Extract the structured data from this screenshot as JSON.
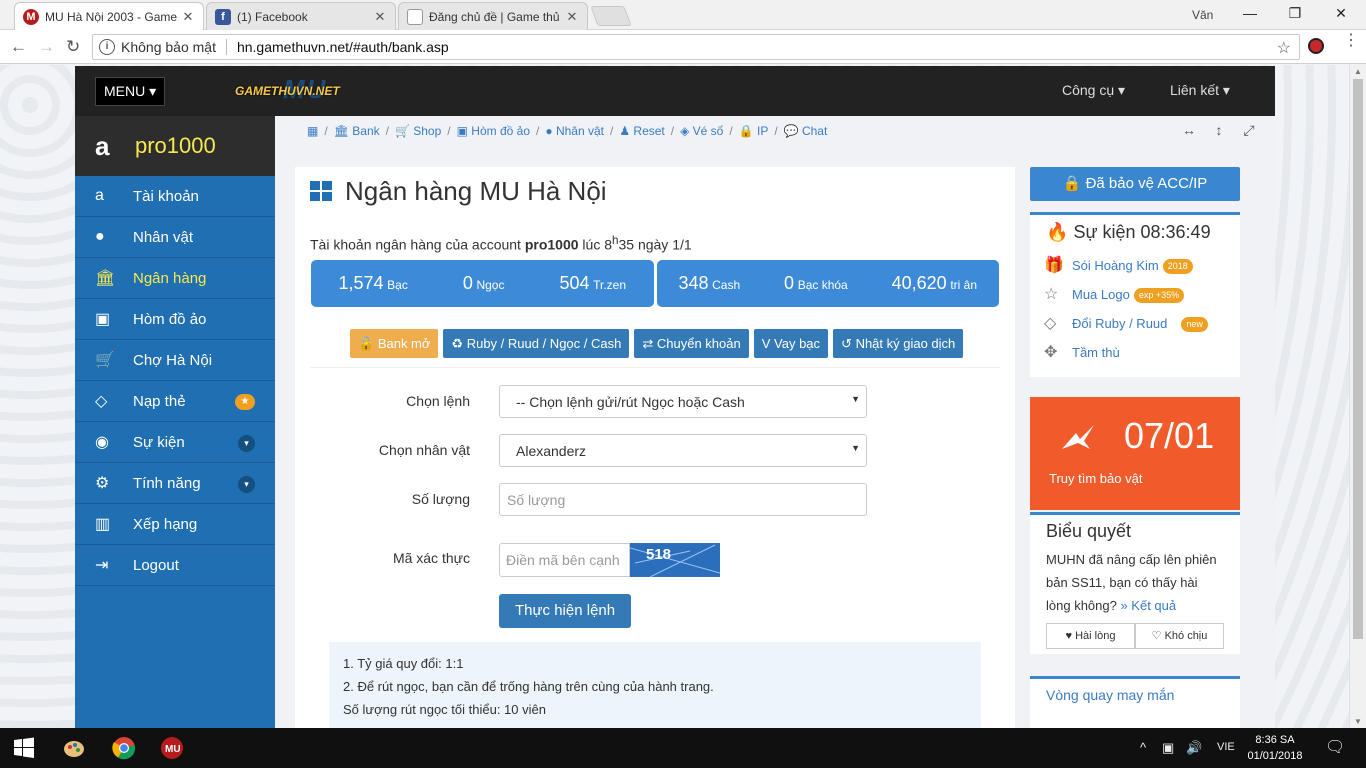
{
  "browser": {
    "tabs": [
      {
        "title": "MU Hà Nội 2003 - Game",
        "active": true
      },
      {
        "title": "(1) Facebook",
        "active": false
      },
      {
        "title": "Đăng chủ đề | Game thủ",
        "active": false
      }
    ],
    "user": "Văn",
    "security": "Không bảo mật",
    "url": "hn.gamethuvn.net/#auth/bank.asp"
  },
  "header": {
    "menu_label": "MENU",
    "logo_big": "MU",
    "logo_text": "GAMETHUVN.NET",
    "links": [
      "Công cụ",
      "Liên kết"
    ]
  },
  "sidebar": {
    "username": "pro1000",
    "items": [
      {
        "label": "Tài khoản",
        "icon": "amazon-icon"
      },
      {
        "label": "Nhân vật",
        "icon": "user-icon"
      },
      {
        "label": "Ngân hàng",
        "icon": "bank-icon",
        "active": true
      },
      {
        "label": "Hòm đồ ảo",
        "icon": "briefcase-icon"
      },
      {
        "label": "Chợ Hà Nội",
        "icon": "cart-icon"
      },
      {
        "label": "Nạp thẻ",
        "icon": "diamond-icon"
      },
      {
        "label": "Sự kiện",
        "icon": "android-icon"
      },
      {
        "label": "Tính năng",
        "icon": "cogs-icon"
      },
      {
        "label": "Xếp hạng",
        "icon": "bar-chart-icon"
      },
      {
        "label": "Logout",
        "icon": "sign-out-icon"
      }
    ]
  },
  "breadcrumb": [
    "Bank",
    "Shop",
    "Hòm đồ ảo",
    "Nhân vật",
    "Reset",
    "Vé số",
    "IP",
    "Chat"
  ],
  "main": {
    "title": "Ngân hàng MU Hà Nội",
    "account_prefix": "Tài khoản ngân hàng của account",
    "account_name": "pro1000",
    "account_time_a": "lúc 8",
    "account_time_sup": "h",
    "account_time_b": "35 ngày 1/1",
    "stats_left": [
      {
        "value": "1,574",
        "unit": "Bạc"
      },
      {
        "value": "0",
        "unit": "Ngọc"
      },
      {
        "value": "504",
        "unit": "Tr.zen"
      }
    ],
    "stats_right": [
      {
        "value": "348",
        "unit": "Cash"
      },
      {
        "value": "0",
        "unit": "Bạc khóa"
      },
      {
        "value": "40,620",
        "unit": "tri ân"
      }
    ],
    "actions": [
      "Bank mở",
      "Ruby / Ruud / Ngọc / Cash",
      "Chuyển khoản",
      "Vay bạc",
      "Nhật ký giao dịch"
    ],
    "form": {
      "command_label": "Chọn lệnh",
      "command_value": "-- Chọn lệnh gửi/rút Ngọc hoặc Cash",
      "character_label": "Chọn nhân vật",
      "character_value": "Alexanderz",
      "amount_label": "Số lượng",
      "amount_placeholder": "Số lượng",
      "captcha_label": "Mã xác thực",
      "captcha_placeholder": "Điền mã bên cạnh",
      "captcha_text": "518",
      "submit": "Thực hiện lệnh"
    },
    "notes": [
      "1. Tỷ giá quy đổi: 1:1",
      "2. Để rút ngọc, bạn cần để trống hàng trên cùng của hành trang.",
      "Số lượng rút ngọc tối thiểu: 10 viên"
    ]
  },
  "right": {
    "protect": "Đã bảo vệ ACC/IP",
    "event_title": "Sự kiện 08:36:49",
    "events": [
      {
        "label": "Sói Hoàng Kim",
        "tag": "2018",
        "tag_color": "#f0a020",
        "icon": "gift-icon"
      },
      {
        "label": "Mua Logo",
        "tag": "exp +35%",
        "tag_color": "#f0a020",
        "icon": "star-icon"
      },
      {
        "label": "Đổi Ruby / Ruud",
        "tag": "new",
        "tag_color": "#f0a020",
        "icon": "diamond-icon"
      },
      {
        "label": "Tầm thù",
        "tag": "",
        "tag_color": "",
        "icon": "crosshair-icon"
      }
    ],
    "treasure_date": "07/01",
    "treasure_label": "Truy tìm bảo vật",
    "poll_title": "Biểu quyết",
    "poll_text": "MUHN đã nâng cấp lên phiên bản SS11, bạn có thấy hài lòng không?",
    "poll_result": "» Kết quả",
    "poll_yes": "Hài lòng",
    "poll_no": "Khó chịu",
    "lucky": "Vòng quay may mắn"
  },
  "taskbar": {
    "lang": "VIE",
    "time": "8:36 SA",
    "date": "01/01/2018"
  }
}
